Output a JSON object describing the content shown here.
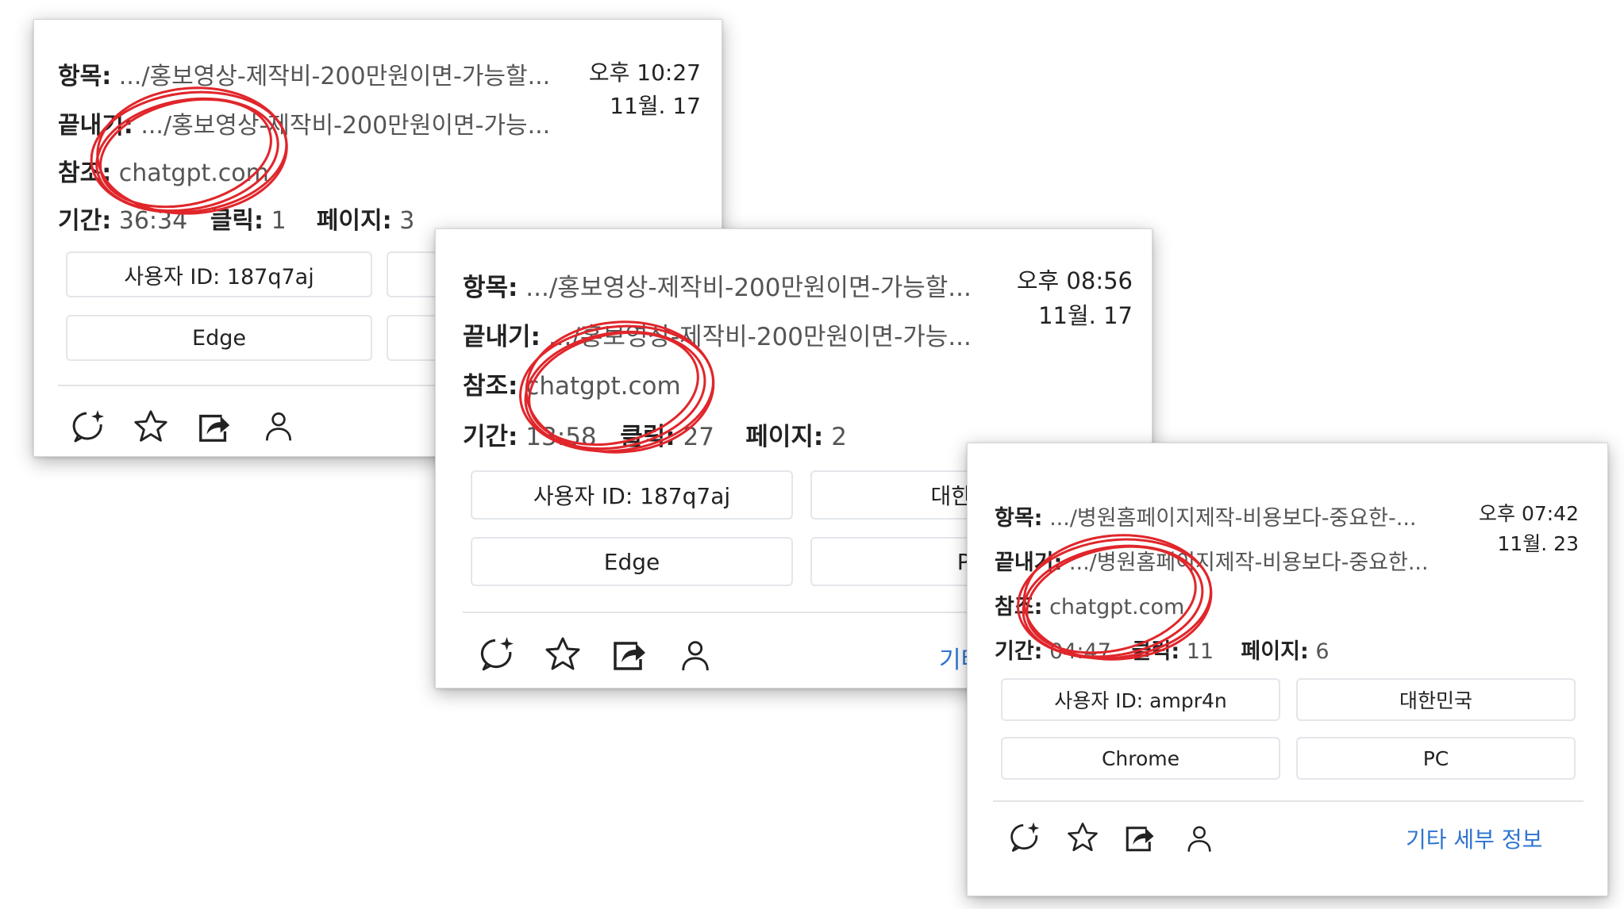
{
  "cards": [
    {
      "item_label": "항목:",
      "item_value": ".../홍보영상-제작비-200만원이면-가능할...",
      "exit_label": "끝내기:",
      "exit_value": ".../홍보영상-제작비-200만원이면-가능...",
      "ref_label": "참조:",
      "ref_value": "chatgpt.com",
      "duration_label": "기간:",
      "duration_value": "36:34",
      "clicks_label": "클릭:",
      "clicks_value": "1",
      "pages_label": "페이지:",
      "pages_value": "3",
      "time": "오후 10:27",
      "date": "11월. 17",
      "user_id": "사용자 ID: 187q7aj",
      "browser": "Edge"
    },
    {
      "item_label": "항목:",
      "item_value": ".../홍보영상-제작비-200만원이면-가능할...",
      "exit_label": "끝내기:",
      "exit_value": ".../홍보영상-제작비-200만원이면-가능...",
      "ref_label": "참조:",
      "ref_value": "chatgpt.com",
      "duration_label": "기간:",
      "duration_value": "13:58",
      "clicks_label": "클릭:",
      "clicks_value": "27",
      "pages_label": "페이지:",
      "pages_value": "2",
      "time": "오후 08:56",
      "date": "11월. 17",
      "user_id": "사용자 ID: 187q7aj",
      "country": "대한민국",
      "browser": "Edge",
      "device": "PC",
      "more": "기타 세부 정보"
    },
    {
      "item_label": "항목:",
      "item_value": ".../병원홈페이지제작-비용보다-중요한-...",
      "exit_label": "끝내기:",
      "exit_value": ".../병원홈페이지제작-비용보다-중요한...",
      "ref_label": "참조:",
      "ref_value": "chatgpt.com",
      "duration_label": "기간:",
      "duration_value": "04:47",
      "clicks_label": "클릭:",
      "clicks_value": "11",
      "pages_label": "페이지:",
      "pages_value": "6",
      "time": "오후 07:42",
      "date": "11월. 23",
      "user_id": "사용자 ID: ampr4n",
      "country": "대한민국",
      "browser": "Chrome",
      "device": "PC",
      "more": "기타 세부 정보"
    }
  ],
  "annotation_color": "#e0262b",
  "link_color": "#2f74d0"
}
